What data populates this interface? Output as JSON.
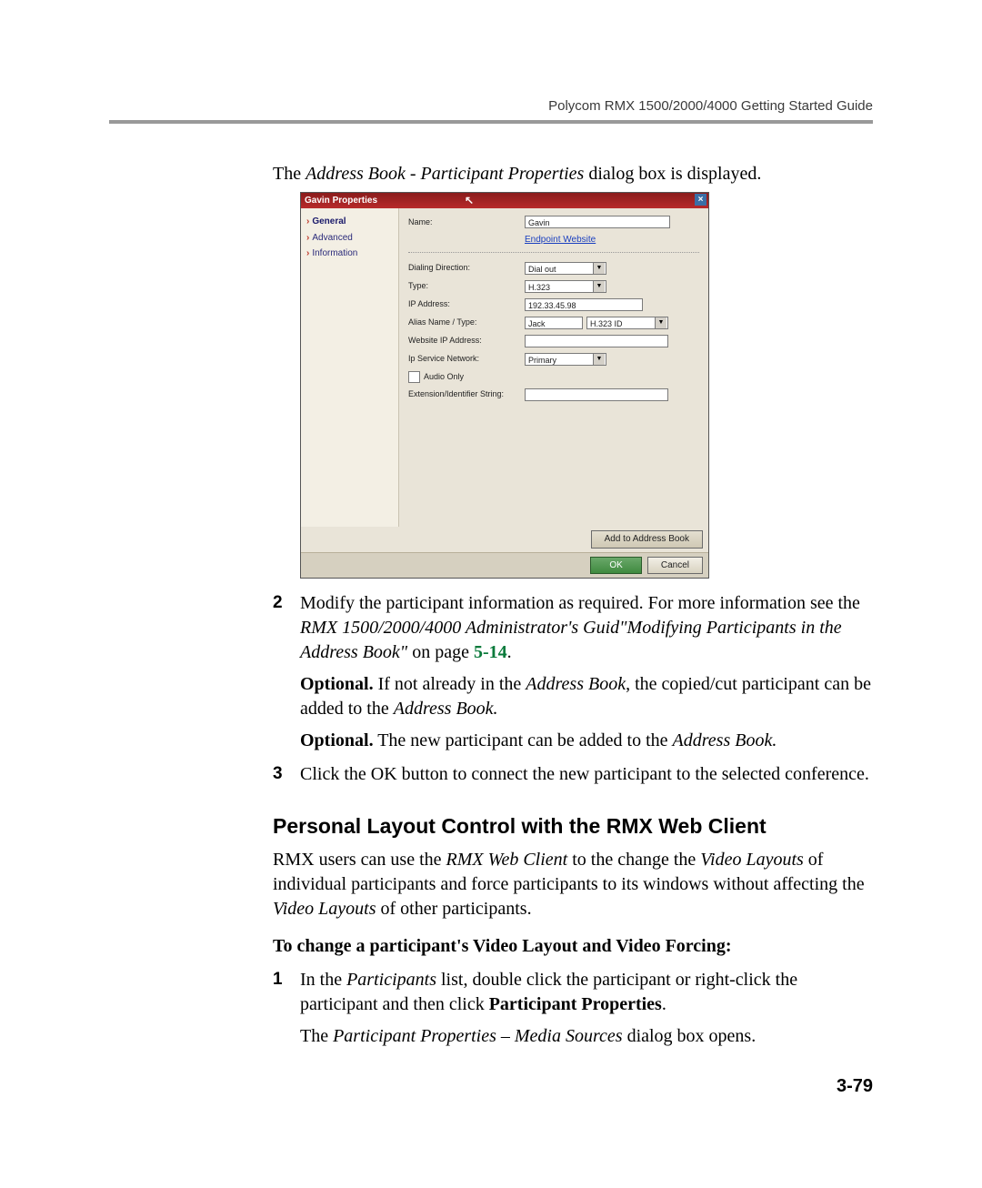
{
  "header": {
    "running_head": "Polycom RMX 1500/2000/4000 Getting Started Guide"
  },
  "intro": "The Address Book - Participant Properties dialog box is displayed.",
  "dialog": {
    "title": "Gavin Properties",
    "nav": {
      "items": [
        {
          "label": "General",
          "selected": true
        },
        {
          "label": "Advanced",
          "selected": false
        },
        {
          "label": "Information",
          "selected": false
        }
      ]
    },
    "form": {
      "name_label": "Name:",
      "name_value": "Gavin",
      "endpoint_link": "Endpoint Website",
      "dialing_direction_label": "Dialing Direction:",
      "dialing_direction_value": "Dial out",
      "type_label": "Type:",
      "type_value": "H.323",
      "ip_address_label": "IP Address:",
      "ip_address_value": "192.33.45.98",
      "alias_label": "Alias Name / Type:",
      "alias_name_value": "Jack",
      "alias_type_value": "H.323 ID",
      "website_ip_label": "Website IP Address:",
      "website_ip_value": "",
      "ip_service_label": "Ip Service Network:",
      "ip_service_value": "Primary",
      "audio_only_label": "Audio Only",
      "ext_label": "Extension/Identifier String:",
      "ext_value": ""
    },
    "buttons": {
      "add_to_address_book": "Add to Address Book",
      "ok": "OK",
      "cancel": "Cancel"
    }
  },
  "steps": {
    "two_num": "2",
    "two_text_a": "Modify the participant information as required. For more information see the ",
    "two_text_b_italic": "RMX 1500/2000/4000 Administrator's Guid\"Modifying Participants in the Address Book\"",
    "two_text_c": " on page ",
    "two_page_ref": "5-14",
    "two_opt1_a": "Optional.",
    "two_opt1_b": " If not already in the ",
    "two_opt1_c_italic": "Address Book",
    "two_opt1_d": ", the copied/cut participant can be added to the ",
    "two_opt1_e_italic": "Address Book.",
    "two_opt2_a": "Optional.",
    "two_opt2_b": " The new participant can be added to the ",
    "two_opt2_c_italic": "Address Book.",
    "three_num": "3",
    "three_text": "Click the OK button to connect the new participant to the selected conference."
  },
  "section_heading": "Personal Layout Control with the RMX Web Client",
  "section_para_a": "RMX users can use the ",
  "section_para_b_italic": "RMX Web Client",
  "section_para_c": " to the change the ",
  "section_para_d_italic": "Video Layouts",
  "section_para_e": " of individual participants and force participants to its windows without affecting the ",
  "section_para_f_italic": "Video Layouts",
  "section_para_g": " of other participants.",
  "subhead": "To change a participant's Video Layout and Video Forcing:",
  "step1_num": "1",
  "step1_a": "In the ",
  "step1_b_italic": "Participants",
  "step1_c": " list, double click the participant or right-click the participant and then click ",
  "step1_d_bold": "Participant Properties",
  "step1_e": ".",
  "step1_follow_a": "The ",
  "step1_follow_b_italic": "Participant Properties – Media Sources",
  "step1_follow_c": " dialog box opens.",
  "page_number": "3-79"
}
